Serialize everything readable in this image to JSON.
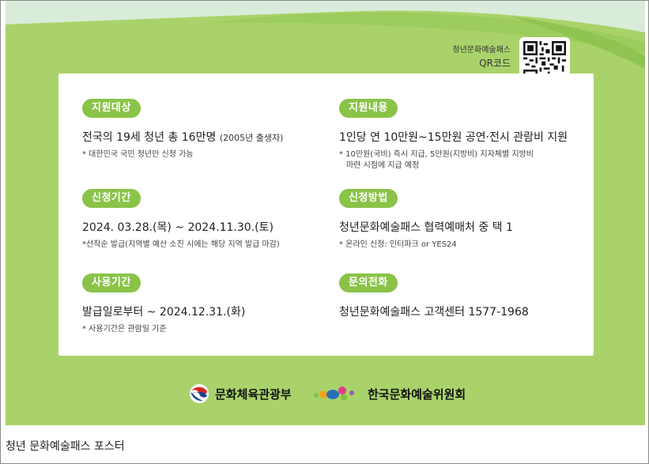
{
  "poster": {
    "qr": {
      "title": "청년문화예술패스",
      "subtitle": "QR코드"
    },
    "sections": [
      {
        "id": "target",
        "label": "지원대상",
        "main": "전국의 19세 청년 총 16만명",
        "main_small": "(2005년 출생자)",
        "notes": [
          "* 대한민국 국민 청년만 신청 가능"
        ]
      },
      {
        "id": "content",
        "label": "지원내용",
        "main": "1인당 연 10만원~15만원 공연·전시 관람비 지원",
        "main_small": "",
        "notes": [
          "* 10만원(국비) 즉시 지급, 5만원(지방비) 지자체별 지방비",
          "마련 시점에 지급 예정"
        ]
      },
      {
        "id": "period",
        "label": "신청기간",
        "main": "2024. 03.28.(목) ~ 2024.11.30.(토)",
        "main_small": "",
        "notes": [
          "*선착순 발급(지역별 예산 소진 시에는 해당 지역 발급 마감)"
        ]
      },
      {
        "id": "method",
        "label": "신청방법",
        "main": "청년문화예술패스 협력예매처 중 택 1",
        "main_small": "",
        "notes": [
          "* 온라인 신청: 인터파크 or YES24"
        ]
      },
      {
        "id": "usage",
        "label": "사용기간",
        "main": "발급일로부터 ~ 2024.12.31.(화)",
        "main_small": "",
        "notes": [
          "* 사용기간은 관람일 기준"
        ]
      },
      {
        "id": "contact",
        "label": "문의전화",
        "main": "청년문화예술패스 고객센터  1577-1968",
        "main_small": "",
        "notes": []
      }
    ],
    "logos": {
      "ministry": "문화체육관광부",
      "council": "한국문화예술위원회"
    },
    "colors": {
      "background": "#a9d36a",
      "pill": "#8ac348",
      "hill_dark": "#8fc451",
      "sky": "#d9ecd9"
    }
  },
  "caption": "청년 문화예술패스 포스터"
}
